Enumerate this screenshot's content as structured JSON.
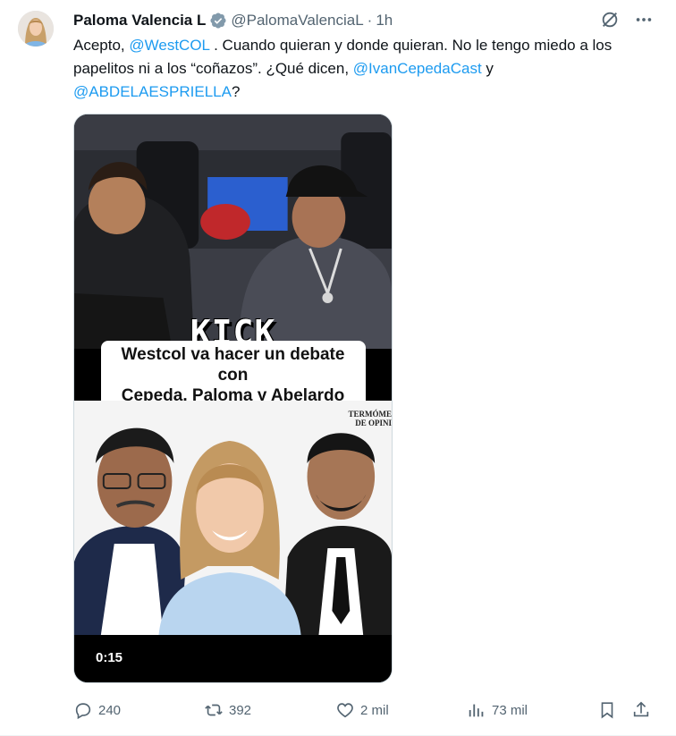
{
  "tweet": {
    "author": {
      "display_name": "Paloma Valencia L",
      "handle": "@PalomaValenciaL",
      "verified": true
    },
    "separator": "·",
    "time": "1h",
    "text_parts": {
      "t1": "Acepto, ",
      "m1": "@WestCOL",
      "t2": " . Cuando quieran y donde quieran. No le tengo miedo a los papelitos ni a los “coñazos”. ¿Qué dicen, ",
      "m2": "@IvanCepedaCast",
      "t3": " y ",
      "m3": "@ABDELAESPRIELLA",
      "t4": "?"
    },
    "media": {
      "kick_label": "KICK",
      "headline_line1": "Westcol va hacer un debate con",
      "headline_line2": "Cepeda, Paloma y Abelardo",
      "watermark_line1": "TERMÓME",
      "watermark_line2": "DE OPINI",
      "duration": "0:15"
    },
    "metrics": {
      "replies": "240",
      "reposts": "392",
      "likes": "2 mil",
      "views": "73 mil"
    },
    "icons": [
      "verified-badge-icon",
      "grok-icon",
      "more-icon",
      "reply-icon",
      "repost-icon",
      "like-icon",
      "views-icon",
      "bookmark-icon",
      "share-icon"
    ],
    "colors": {
      "link": "#1d9bf0",
      "secondary_text": "#536471",
      "primary_text": "#0f1419",
      "verified": "#829aab"
    }
  }
}
